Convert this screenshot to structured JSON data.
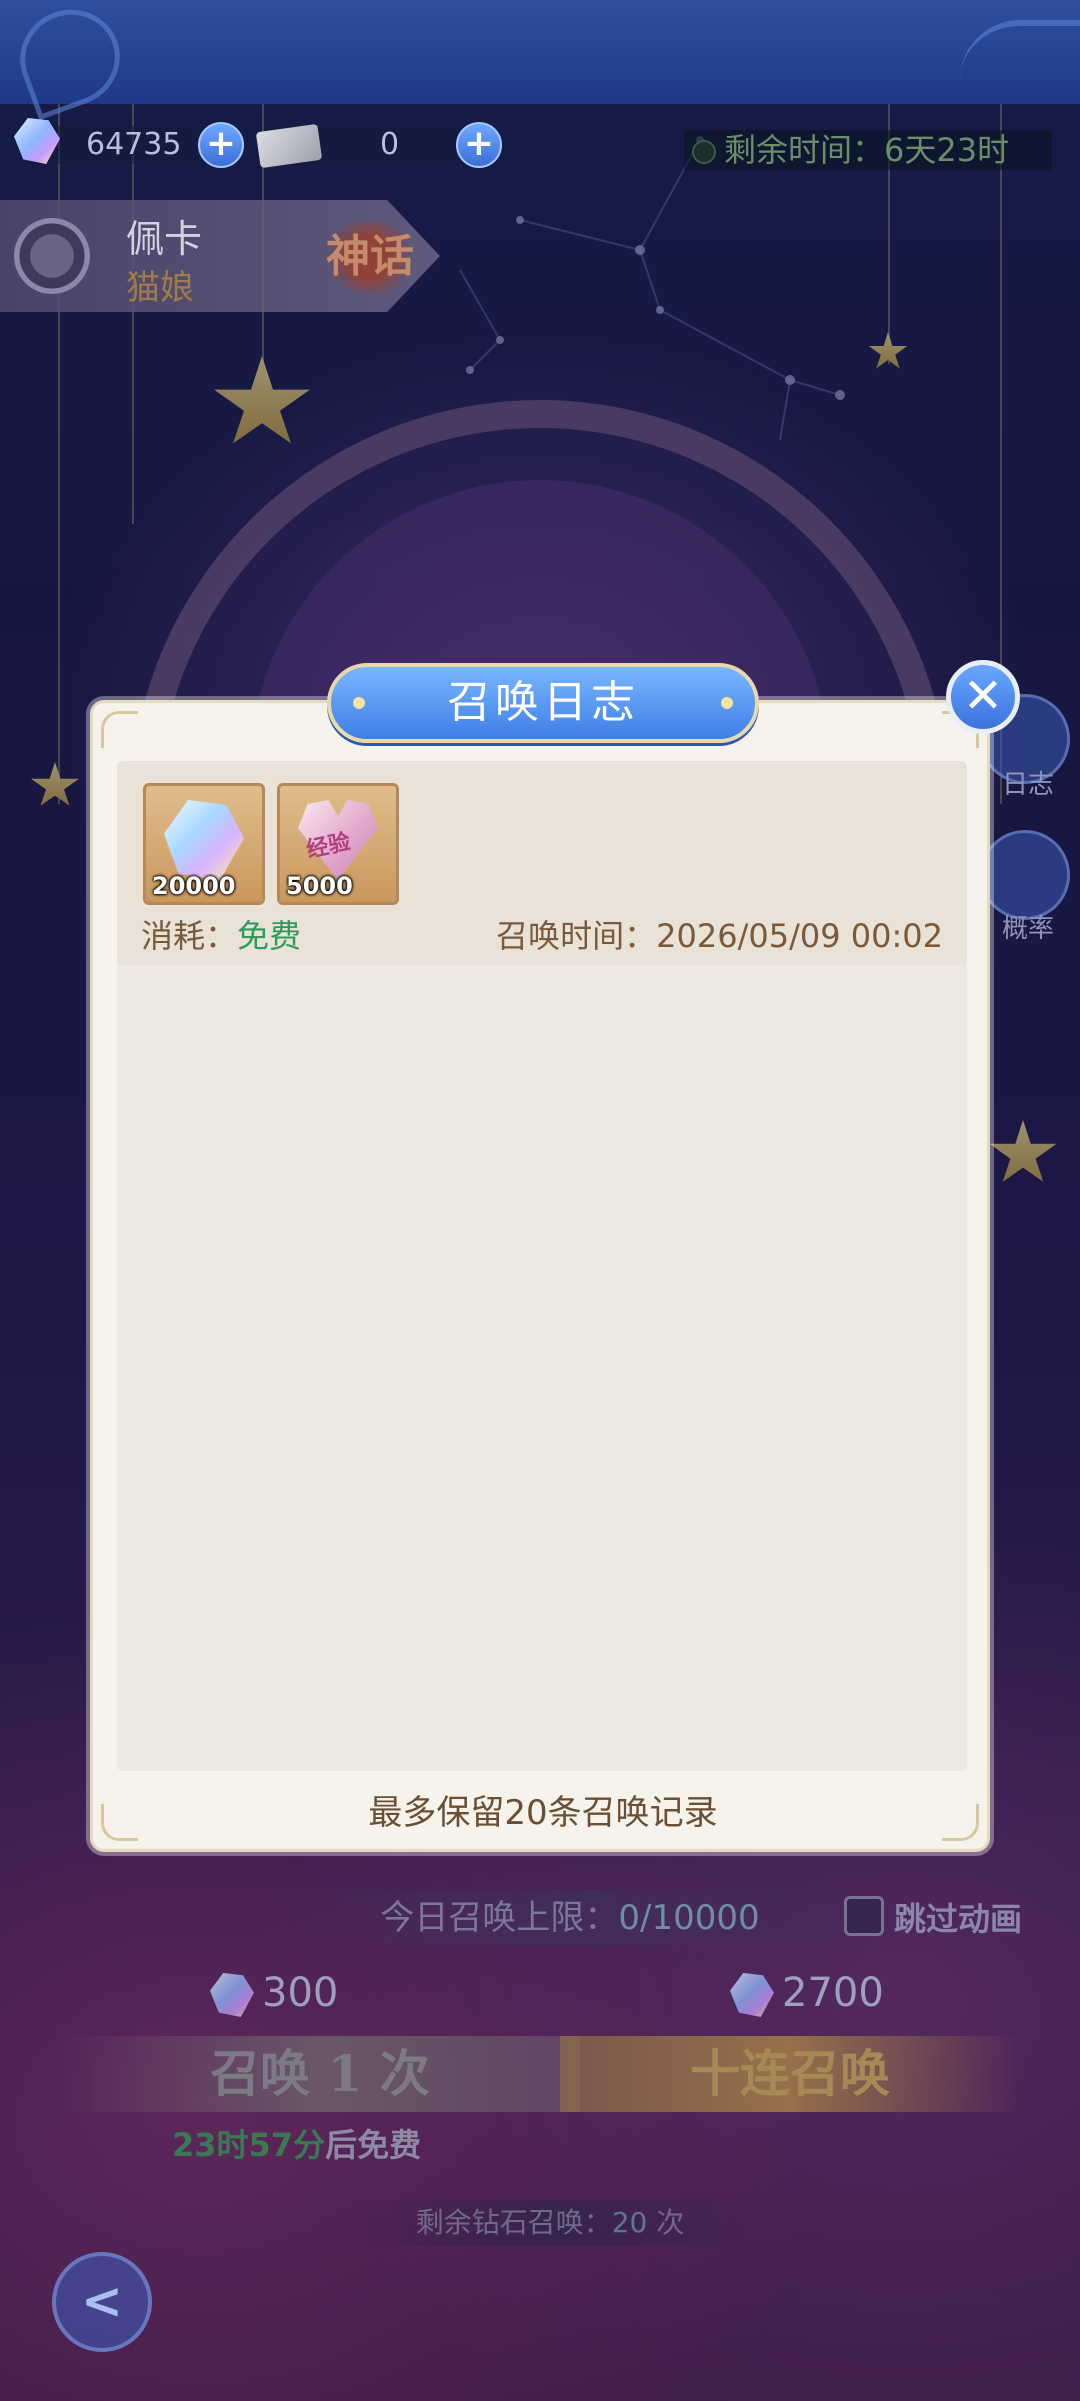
{
  "header": {
    "diamond_count": "64735",
    "ticket_count": "0",
    "timer_text": "剩余时间：6天23时"
  },
  "hero": {
    "name": "佩卡",
    "title": "猫娘",
    "rank": "神话"
  },
  "side_buttons": [
    {
      "label": "日志"
    },
    {
      "label": "概率"
    }
  ],
  "modal": {
    "title": "召唤日志",
    "close_icon": "close-icon",
    "entries": [
      {
        "rewards": [
          {
            "icon": "diamond-icon",
            "count": "20000"
          },
          {
            "icon": "exp-heart-icon",
            "art_text": "经验",
            "count": "5000"
          }
        ],
        "cost_label": "消耗：",
        "cost_value": "免费",
        "time_label": "召唤时间：",
        "time_value": "2026/05/09 00:02"
      }
    ],
    "footer_note": "最多保留20条召唤记录"
  },
  "bottom": {
    "limit_label": "今日召唤上限：",
    "limit_value": "0/10000",
    "skip_animation_label": "跳过动画",
    "single_cost": "300",
    "ten_cost": "2700",
    "single_summon_label": "召唤 1 次",
    "ten_summon_label": "十连召唤",
    "free_countdown_value": "23时57分",
    "free_countdown_suffix": "后免费",
    "remaining_label": "剩余钻石召唤：",
    "remaining_value": "20",
    "remaining_unit": "次"
  },
  "colors": {
    "accent_blue": "#3f7fe6",
    "free_green": "#2f9a5a",
    "modal_bg": "#f5f3ec",
    "text_brown": "#7a5a3a"
  }
}
